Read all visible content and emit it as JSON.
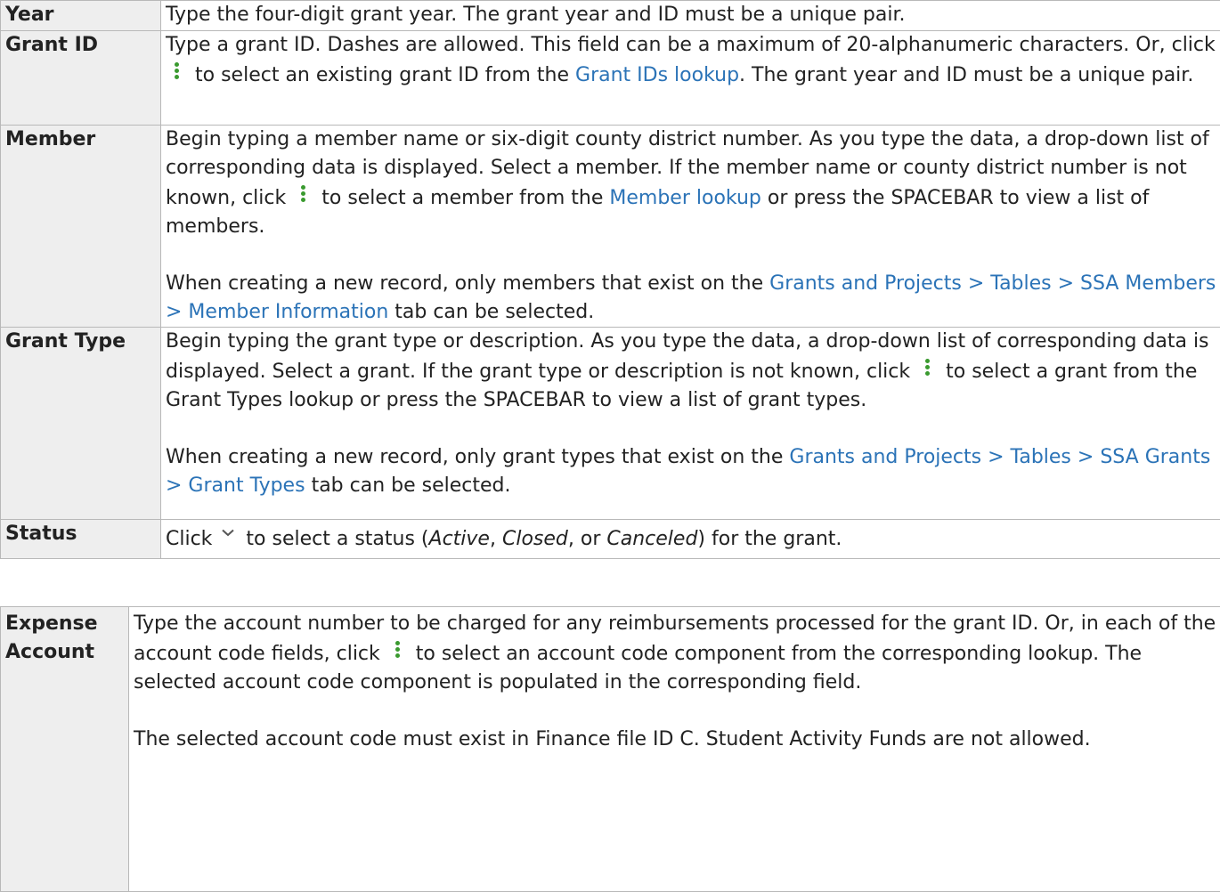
{
  "rows": {
    "year": {
      "term": "Year",
      "text": "Type the four-digit grant year. The grant year and ID must be a unique pair."
    },
    "grant_id": {
      "term": "Grant ID",
      "text1": "Type a grant ID. Dashes are allowed. This field can be a maximum of 20-alphanumeric characters. Or, click",
      "text2": "to select an existing grant ID from the",
      "link": "Grant IDs lookup",
      "text3": ". The grant year and ID must be a unique pair."
    },
    "member": {
      "term": "Member",
      "p1_text1": "Begin typing a member name or six-digit county district number. As you type the data, a drop-down list of corresponding data is displayed. Select a member. If the member name or county district number is not known, click",
      "p1_text2": "to select a member from the",
      "p1_link": "Member lookup",
      "p1_text3": "or press the SPACEBAR to view a list of members.",
      "p2_text1": "When creating a new record, only members that exist on the",
      "p2_link": "Grants and Projects > Tables > SSA Members > Member Information",
      "p2_text2": "tab can be selected."
    },
    "grant_type": {
      "term": "Grant Type",
      "p1_text1": "Begin typing the grant type or description. As you type the data, a drop-down list of corresponding data is displayed. Select a grant. If the grant type or description is not known, click",
      "p1_text2": "to select a grant from the Grant Types lookup or press the SPACEBAR to view a list of grant types.",
      "p2_text1": "When creating a new record, only grant types that exist on the",
      "p2_link": "Grants and Projects > Tables > SSA Grants > Grant Types",
      "p2_text2": "tab can be selected."
    },
    "status": {
      "term": "Status",
      "text1": "Click",
      "text2": "to select a status (",
      "opt_active": "Active",
      "sep1": ",",
      "opt_closed": "Closed",
      "sep2": ", or",
      "opt_canceled": "Canceled",
      "text3": ") for the grant."
    },
    "expense_account": {
      "term": "Expense Account",
      "p1_text1": "Type the account number to be charged for any reimbursements processed for the grant ID. Or, in each of the account code fields, click",
      "p1_text2": "to select an account code component from the corresponding lookup. The selected account code component is populated in the corresponding field.",
      "p2_text": "The selected account code must exist in Finance file ID C. Student Activity Funds are not allowed."
    }
  },
  "icons": {
    "lookup": "vertical-ellipsis-icon",
    "dropdown": "chevron-down-icon",
    "lookup_color": "#3a9a2f",
    "link_color": "#2b73b7"
  }
}
